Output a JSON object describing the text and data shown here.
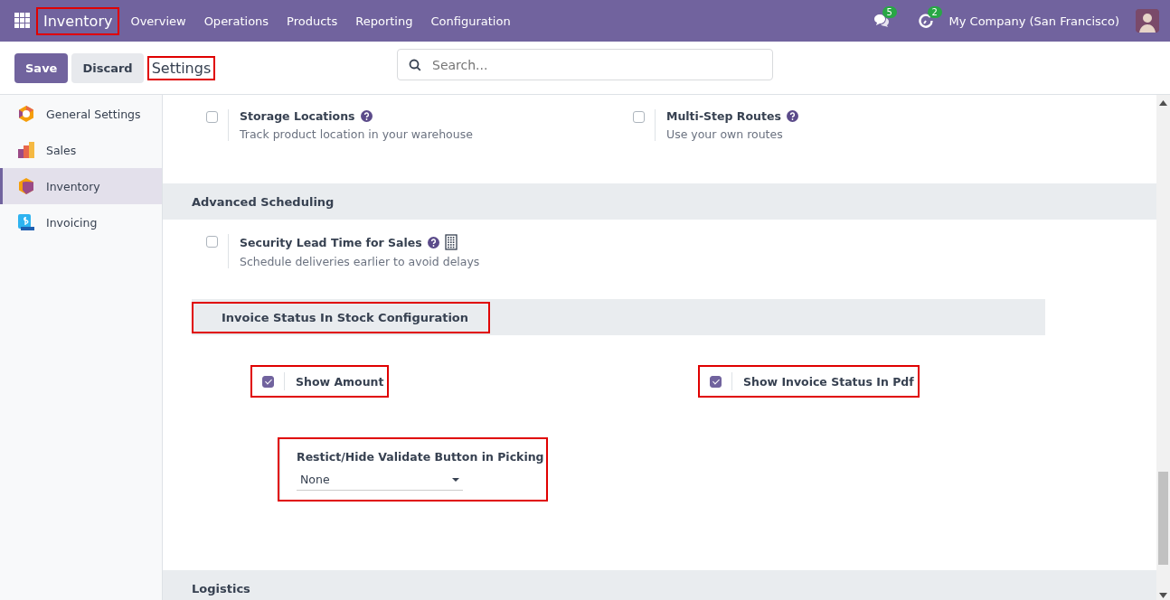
{
  "navbar": {
    "app": "Inventory",
    "app_highlighted": true,
    "menu": [
      "Overview",
      "Operations",
      "Products",
      "Reporting",
      "Configuration"
    ],
    "messages_badge": "5",
    "activities_badge": "2",
    "company": "My Company (San Francisco)"
  },
  "control_panel": {
    "buttons": [
      {
        "label": "Save",
        "kind": "primary"
      },
      {
        "label": "Discard",
        "kind": "secondary"
      }
    ],
    "title": "Settings",
    "title_highlighted": true,
    "search": {
      "placeholder": "Search..."
    }
  },
  "sidebar": {
    "items": [
      {
        "label": "General Settings",
        "kind": "general",
        "selected": false
      },
      {
        "label": "Sales",
        "kind": "sales",
        "selected": false
      },
      {
        "label": "Inventory",
        "kind": "inventory",
        "selected": true
      },
      {
        "label": "Invoicing",
        "kind": "invoicing",
        "selected": false
      }
    ]
  },
  "content": [
    {
      "kind": "settings",
      "settings": [
        {
          "title": "Storage Locations",
          "description": "Track product location in your warehouse",
          "checked": false,
          "company_specific": false
        },
        {
          "title": "Multi-Step Routes",
          "description": "Use your own routes",
          "checked": false,
          "company_specific": false
        }
      ]
    },
    {
      "kind": "section",
      "title": "Advanced Scheduling"
    },
    {
      "kind": "settings",
      "settings": [
        {
          "title": "Security Lead Time for Sales",
          "description": "Schedule deliveries earlier to avoid delays",
          "checked": false,
          "company_specific": true
        }
      ]
    },
    {
      "kind": "subsection",
      "title": "Invoice Status In Stock Configuration",
      "highlighted": true,
      "options": [
        {
          "title": "Show Amount",
          "checked": true,
          "highlighted": true
        },
        {
          "title": "Show Invoice Status In Pdf",
          "checked": true,
          "highlighted": true
        }
      ],
      "select": {
        "label": "Restict/Hide Validate Button in Picking",
        "value": "None",
        "highlighted": true
      }
    },
    {
      "kind": "section",
      "title": "Logistics"
    }
  ]
}
